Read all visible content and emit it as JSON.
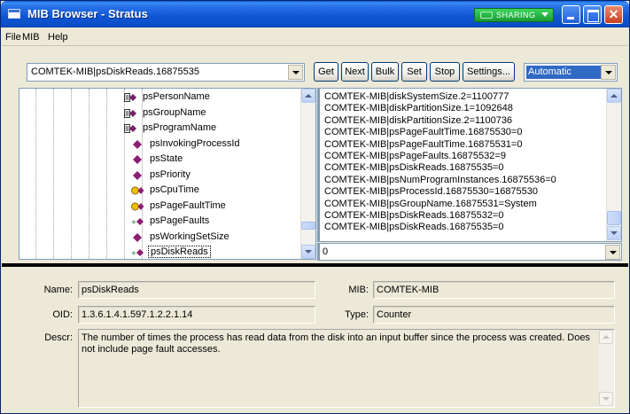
{
  "window": {
    "title": "MIB Browser - Stratus",
    "sharing_label": "SHARING"
  },
  "menu": {
    "items": [
      "File",
      "MIB",
      "Help"
    ]
  },
  "toolbar": {
    "oid_value": "COMTEK-MIB|psDiskReads.16875535",
    "buttons": [
      "Get",
      "Next",
      "Bulk",
      "Set",
      "Stop",
      "Settings..."
    ],
    "mode_value": "Automatic"
  },
  "tree": {
    "items": [
      {
        "label": "psPersonName",
        "icon": "table-column-icon"
      },
      {
        "label": "psGroupName",
        "icon": "table-column-icon"
      },
      {
        "label": "psProgramName",
        "icon": "table-column-icon"
      },
      {
        "label": "psInvokingProcessId",
        "icon": "leaf-diamond-icon"
      },
      {
        "label": "psState",
        "icon": "leaf-diamond-icon"
      },
      {
        "label": "psPriority",
        "icon": "leaf-diamond-icon"
      },
      {
        "label": "psCpuTime",
        "icon": "timeticks-icon"
      },
      {
        "label": "psPageFaultTime",
        "icon": "timeticks-icon"
      },
      {
        "label": "psPageFaults",
        "icon": "counter-icon"
      },
      {
        "label": "psWorkingSetSize",
        "icon": "leaf-diamond-icon"
      },
      {
        "label": "psDiskReads",
        "icon": "counter-icon",
        "selected": true
      }
    ]
  },
  "results": {
    "lines": [
      "COMTEK-MIB|diskSystemSize.2=1100777",
      "COMTEK-MIB|diskPartitionSize.1=1092648",
      "COMTEK-MIB|diskPartitionSize.2=1100736",
      "COMTEK-MIB|psPageFaultTime.16875530=0",
      "COMTEK-MIB|psPageFaultTime.16875531=0",
      "COMTEK-MIB|psPageFaults.16875532=9",
      "COMTEK-MIB|psDiskReads.16875535=0",
      "COMTEK-MIB|psNumProgramInstances.16875536=0",
      "COMTEK-MIB|psProcessId.16875530=16875530",
      "COMTEK-MIB|psGroupName.16875531=System",
      "COMTEK-MIB|psDiskReads.16875532=0",
      "COMTEK-MIB|psDiskReads.16875535=0"
    ],
    "input_value": "0"
  },
  "details": {
    "name_label": "Name:",
    "name_value": "psDiskReads",
    "mib_label": "MIB:",
    "mib_value": "COMTEK-MIB",
    "oid_label": "OID:",
    "oid_value": "1.3.6.1.4.1.597.1.2.2.1.14",
    "type_label": "Type:",
    "type_value": "Counter",
    "descr_label": "Descr:",
    "descr_value": "The number of times the process has read data from the disk into an input buffer since the process was created. Does not include page fault accesses."
  },
  "colors": {
    "titlebar": "#0b4fc9",
    "sharing_badge": "#1a9a34",
    "selection": "#316ac5",
    "window_bg": "#ece9d8"
  }
}
